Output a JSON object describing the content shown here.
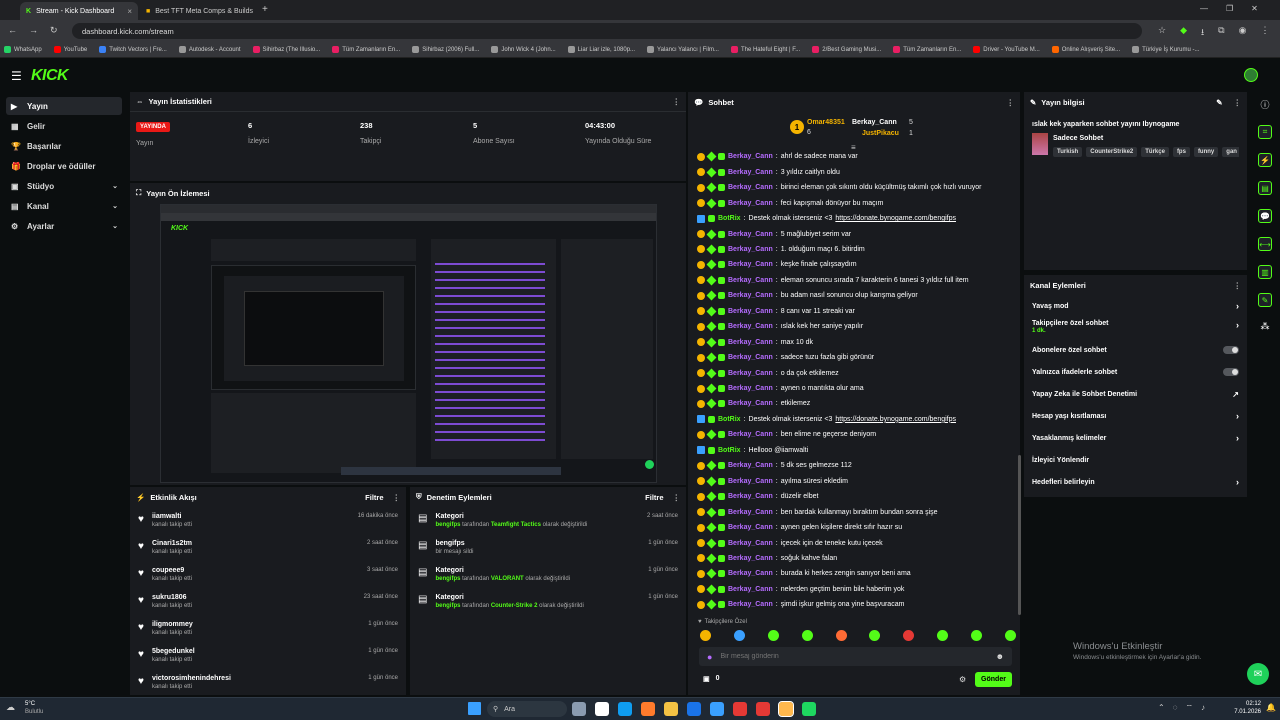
{
  "browser": {
    "tabs": [
      {
        "title": "Stream - Kick Dashboard",
        "active": true
      },
      {
        "title": "Best TFT Meta Comps & Builds",
        "active": false
      }
    ],
    "new_tab": "+",
    "url": "dashboard.kick.com/stream",
    "bookmarks": [
      {
        "label": "WhatsApp",
        "color": "#25d366"
      },
      {
        "label": "YouTube",
        "color": "#ff0000"
      },
      {
        "label": "Twitch Vectors | Fre...",
        "color": "#3b82f6"
      },
      {
        "label": "Autodesk - Account",
        "color": "#999999"
      },
      {
        "label": "Sihirbaz (The Illusio...",
        "color": "#e91e63"
      },
      {
        "label": "Tüm Zamanların En...",
        "color": "#e91e63"
      },
      {
        "label": "Sihirbaz (2006) Full...",
        "color": "#999999"
      },
      {
        "label": "John Wick 4 (John...",
        "color": "#999999"
      },
      {
        "label": "Liar Liar izle, 1080p...",
        "color": "#999999"
      },
      {
        "label": "Yalancı Yalancı | Film...",
        "color": "#999999"
      },
      {
        "label": "The Hateful Eight | F...",
        "color": "#e91e63"
      },
      {
        "label": "2/Best Gaming Musi...",
        "color": "#e91e63"
      },
      {
        "label": "Tüm Zamanların En...",
        "color": "#e91e63"
      },
      {
        "label": "Driver - YouTube M...",
        "color": "#ff0000"
      },
      {
        "label": "Online Alışveriş Site...",
        "color": "#ff6600"
      },
      {
        "label": "Türkiye İş Kurumu -...",
        "color": "#999999"
      }
    ]
  },
  "brand": {
    "logo": "KICK",
    "accent": "#53fc18"
  },
  "sidebar": {
    "items": [
      {
        "label": "Yayın",
        "icon": "broadcast-icon",
        "selected": true
      },
      {
        "label": "Gelir",
        "icon": "wallet-icon"
      },
      {
        "label": "Başarılar",
        "icon": "trophy-icon"
      },
      {
        "label": "Droplar ve ödüller",
        "icon": "gift-icon"
      },
      {
        "label": "Stüdyo",
        "icon": "studio-icon",
        "chevron": true
      },
      {
        "label": "Kanal",
        "icon": "channel-icon",
        "chevron": true
      },
      {
        "label": "Ayarlar",
        "icon": "gear-icon",
        "chevron": true
      }
    ]
  },
  "stats": {
    "title": "Yayın İstatistikleri",
    "live_badge": "YAYINDA",
    "live_label": "Yayın",
    "items": [
      {
        "value": "6",
        "label": "İzleyici"
      },
      {
        "value": "238",
        "label": "Takipçi"
      },
      {
        "value": "5",
        "label": "Abone Sayısı"
      },
      {
        "value": "04:43:00",
        "label": "Yayında Olduğu Süre"
      }
    ]
  },
  "preview": {
    "title": "Yayın Ön İzlemesi"
  },
  "activity": {
    "title": "Etkinlik Akışı",
    "filter": "Filtre",
    "items": [
      {
        "name": "iiamwalti",
        "sub": "kanalı takip etti",
        "time": "16 dakika önce"
      },
      {
        "name": "Cinari1s2tm",
        "sub": "kanalı takip etti",
        "time": "2 saat önce"
      },
      {
        "name": "coupeee9",
        "sub": "kanalı takip etti",
        "time": "3 saat önce"
      },
      {
        "name": "sukru1806",
        "sub": "kanalı takip etti",
        "time": "23 saat önce"
      },
      {
        "name": "iligmommey",
        "sub": "kanalı takip etti",
        "time": "1 gün önce"
      },
      {
        "name": "5begedunkel",
        "sub": "kanalı takip etti",
        "time": "1 gün önce"
      },
      {
        "name": "victorosimhenindehresi",
        "sub": "kanalı takip etti",
        "time": "1 gün önce"
      }
    ]
  },
  "moderation": {
    "title": "Denetim Eylemleri",
    "filter": "Filtre",
    "items": [
      {
        "title": "Kategori",
        "pre": "bengifps",
        "mid": " tarafından ",
        "highlight": "Teamfight Tactics",
        "post": " olarak değiştirildi",
        "time": "2 saat önce"
      },
      {
        "title": "bengifps",
        "pre": "",
        "mid": "",
        "highlight": "",
        "post": "bir mesajı sildi",
        "time": "1 gün önce"
      },
      {
        "title": "Kategori",
        "pre": "bengifps",
        "mid": " tarafından ",
        "highlight": "VALORANT",
        "post": " olarak değiştirildi",
        "time": "1 gün önce"
      },
      {
        "title": "Kategori",
        "pre": "bengifps",
        "mid": " tarafından ",
        "highlight": "Counter-Strike 2",
        "post": " olarak değiştirildi",
        "time": "1 gün önce"
      }
    ]
  },
  "chat": {
    "title": "Sohbet",
    "top_gifters": [
      {
        "name": "Omar48351",
        "count": "6"
      },
      {
        "name": "Berkay_Cann",
        "count": "5"
      },
      {
        "name": "JustPikacu",
        "count": "1"
      }
    ],
    "messages": [
      {
        "user": "Berkay_Cann",
        "text": "ahrl de sadece mana var"
      },
      {
        "user": "Berkay_Cann",
        "text": "3 yıldız caitlyn oldu"
      },
      {
        "user": "Berkay_Cann",
        "text": "birinci eleman çok sıkıntı oldu küçültmüş takımlı çok hızlı vuruyor"
      },
      {
        "user": "Berkay_Cann",
        "text": "feci kapışmalı dönüyor bu maçım"
      },
      {
        "user": "BotRix",
        "bot": true,
        "text": "Destek olmak isterseniz <3 ",
        "link": "https://donate.bynogame.com/bengifps"
      },
      {
        "user": "Berkay_Cann",
        "text": "5 mağlubiyet serim var"
      },
      {
        "user": "Berkay_Cann",
        "text": "1. olduğum maçı 6. bitirdim"
      },
      {
        "user": "Berkay_Cann",
        "text": "keşke finale çalışsaydım"
      },
      {
        "user": "Berkay_Cann",
        "text": "eleman sonuncu sırada 7 karakterin 6 tanesi 3 yıldız full item"
      },
      {
        "user": "Berkay_Cann",
        "text": "bu adam nasıl sonuncu olup karışma geliyor"
      },
      {
        "user": "Berkay_Cann",
        "text": "8 canı var 11 streaki var"
      },
      {
        "user": "Berkay_Cann",
        "text": "ıslak kek her saniye yapılır"
      },
      {
        "user": "Berkay_Cann",
        "text": "max 10 dk"
      },
      {
        "user": "Berkay_Cann",
        "text": "sadece tuzu fazla gibi görünür"
      },
      {
        "user": "Berkay_Cann",
        "text": "o da çok etkilemez"
      },
      {
        "user": "Berkay_Cann",
        "text": "aynen o mantıkta olur ama"
      },
      {
        "user": "Berkay_Cann",
        "text": "etkilemez"
      },
      {
        "user": "BotRix",
        "bot": true,
        "text": "Destek olmak isterseniz <3 ",
        "link": "https://donate.bynogame.com/bengifps"
      },
      {
        "user": "Berkay_Cann",
        "text": "ben elime ne geçerse deniyom"
      },
      {
        "user": "BotRix",
        "bot": true,
        "text": "Hellooo @iiamwalti",
        "link": ""
      },
      {
        "user": "Berkay_Cann",
        "text": "5 dk ses gelmezse 112"
      },
      {
        "user": "Berkay_Cann",
        "text": "ayılma süresi ekledim"
      },
      {
        "user": "Berkay_Cann",
        "text": "düzelir elbet"
      },
      {
        "user": "Berkay_Cann",
        "text": "ben bardak kullanmayı bıraktım bundan sonra şişe"
      },
      {
        "user": "Berkay_Cann",
        "text": "aynen gelen kişilere direkt sıfır hazır su"
      },
      {
        "user": "Berkay_Cann",
        "text": "içecek için de teneke kutu içecek"
      },
      {
        "user": "Berkay_Cann",
        "text": "soğuk kahve falan"
      },
      {
        "user": "Berkay_Cann",
        "text": "burada ki herkes zengin sanıyor beni ama"
      },
      {
        "user": "Berkay_Cann",
        "text": "nelerden geçtim benim bile haberim yok"
      },
      {
        "user": "Berkay_Cann",
        "text": "şimdi işkur gelmiş ona yine başvuracam"
      }
    ],
    "mode_label": "Takipçilere Özel",
    "input_placeholder": "Bir mesaj gönderin",
    "points": "0",
    "send_label": "Gönder"
  },
  "stream_info": {
    "title": "Yayın bilgisi",
    "stream_title": "ıslak kek yaparken sohbet yayını Ibynogame",
    "category": "Sadece Sohbet",
    "tags": [
      "Turkish",
      "CounterStrike2",
      "Türkçe",
      "fps",
      "funny",
      "gan"
    ]
  },
  "channel_actions": {
    "title": "Kanal Eylemleri",
    "items": [
      {
        "label": "Yavaş mod",
        "type": "arrow"
      },
      {
        "label": "Takipçilere özel sohbet",
        "sub": "1 dk.",
        "type": "arrow"
      },
      {
        "label": "Abonelere özel sohbet",
        "type": "toggle"
      },
      {
        "label": "Yalnızca ifadelerle sohbet",
        "type": "toggle"
      },
      {
        "label": "Yapay Zeka ile Sohbet Denetimi",
        "type": "external"
      },
      {
        "label": "Hesap yaşı kısıtlaması",
        "type": "arrow"
      },
      {
        "label": "Yasaklanmış kelimeler",
        "type": "arrow"
      },
      {
        "label": "İzleyici Yönlendir",
        "type": "none"
      },
      {
        "label": "Hedefleri belirleyin",
        "type": "arrow"
      }
    ]
  },
  "windows_activation": {
    "title": "Windows'u Etkinleştir",
    "sub": "Windows'u etkinleştirmek için Ayarlar'a gidin."
  },
  "taskbar": {
    "weather_temp": "5°C",
    "weather_text": "Bulutlu",
    "search": "Ara",
    "time": "02:12",
    "date": "7.01.2026"
  }
}
